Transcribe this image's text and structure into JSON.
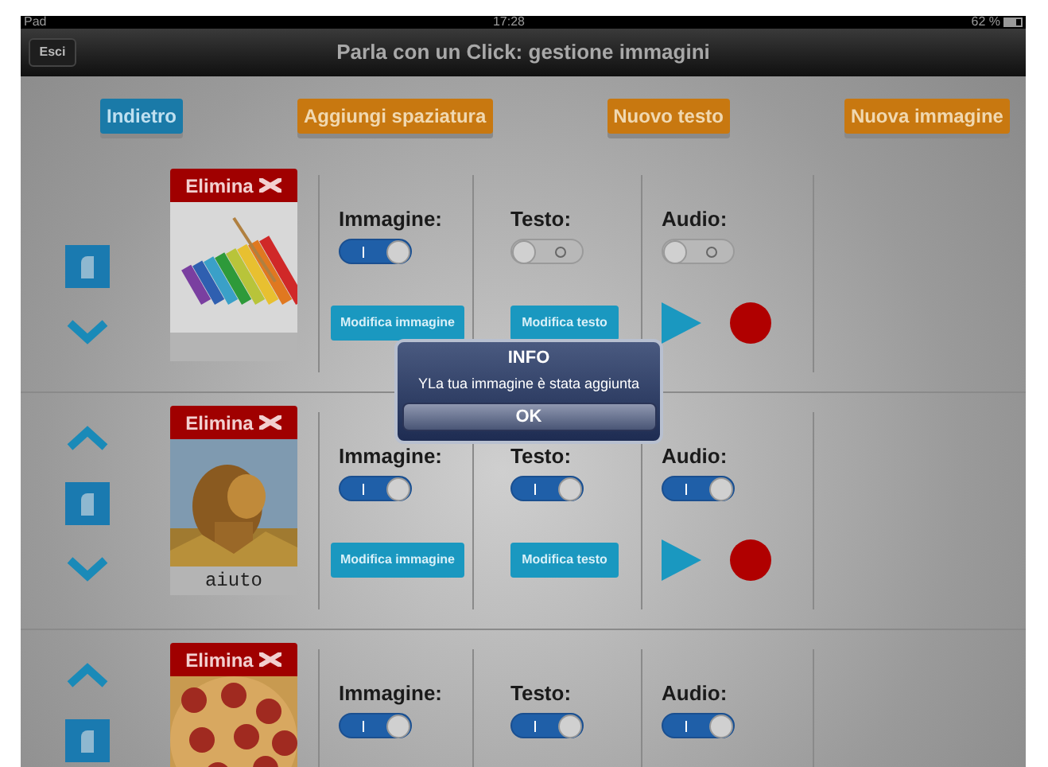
{
  "status_bar": {
    "device": "Pad",
    "time": "17:28",
    "battery": "62 %"
  },
  "nav_bar": {
    "back": "Esci",
    "title": "Parla con un Click: gestione immagini"
  },
  "toolbar": [
    {
      "label": "Indietro",
      "kind": "blue"
    },
    {
      "label": "Aggiungi spaziatura",
      "kind": "orange"
    },
    {
      "label": "Nuovo testo",
      "kind": "orange"
    },
    {
      "label": "Nuova immagine",
      "kind": "orange"
    }
  ],
  "rows": [
    {
      "up": false,
      "down": true,
      "delete": "Elimina",
      "columns": [
        {
          "kind": "edit",
          "label": "Immagine:",
          "on": true,
          "action": "Modifica immagine"
        },
        {
          "kind": "edit",
          "label": "Testo:",
          "on": false,
          "action": "Modifica testo"
        },
        {
          "kind": "audio",
          "label": "Audio:",
          "on": false,
          "player": true
        }
      ]
    },
    {
      "up": true,
      "down": true,
      "delete": "Elimina",
      "caption": "aiuto",
      "columns": [
        {
          "kind": "edit",
          "label": "Immagine:",
          "on": true,
          "action": "Modifica immagine"
        },
        {
          "kind": "edit",
          "label": "Testo:",
          "on": true,
          "action": "Modifica testo"
        },
        {
          "kind": "audio",
          "label": "Audio:",
          "on": true,
          "player": true
        }
      ]
    },
    {
      "up": true,
      "delete": "Elimina",
      "columns": [
        {
          "kind": "edit",
          "label": "Immagine:",
          "on": true
        },
        {
          "kind": "edit",
          "label": "Testo:",
          "on": true
        },
        {
          "kind": "audio",
          "label": "Audio:",
          "on": true
        }
      ]
    }
  ],
  "dialog": {
    "title": "INFO",
    "message": "YLa tua immagine è stata aggiunta",
    "button": "OK"
  }
}
